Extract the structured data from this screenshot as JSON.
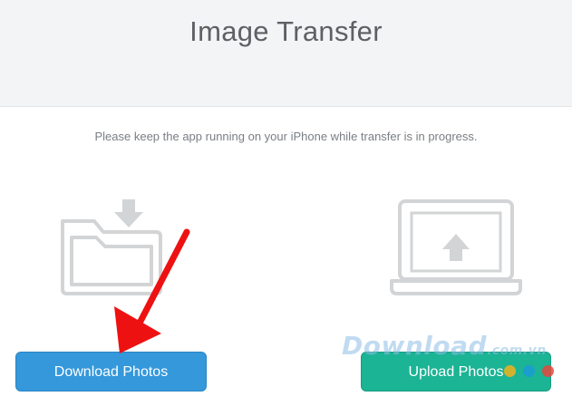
{
  "header": {
    "title": "Image Transfer"
  },
  "main": {
    "subtitle": "Please keep the app running on your iPhone while transfer is in progress.",
    "download": {
      "icon": "folder-download-icon",
      "button_label": "Download Photos"
    },
    "upload": {
      "icon": "laptop-upload-icon",
      "button_label": "Upload Photos"
    }
  },
  "overlay": {
    "watermark_text": "Download",
    "watermark_suffix": ".com.vn",
    "arrow_icon": "red-arrow-icon",
    "dot_colors": [
      "#f1b21b",
      "#1a9ad6",
      "#e8453c"
    ]
  },
  "colors": {
    "header_bg": "#f3f4f5",
    "download_button": "#3498db",
    "upload_button": "#1bb494",
    "icon_gray": "#d2d4d6",
    "annotation_red": "#ee1111"
  }
}
